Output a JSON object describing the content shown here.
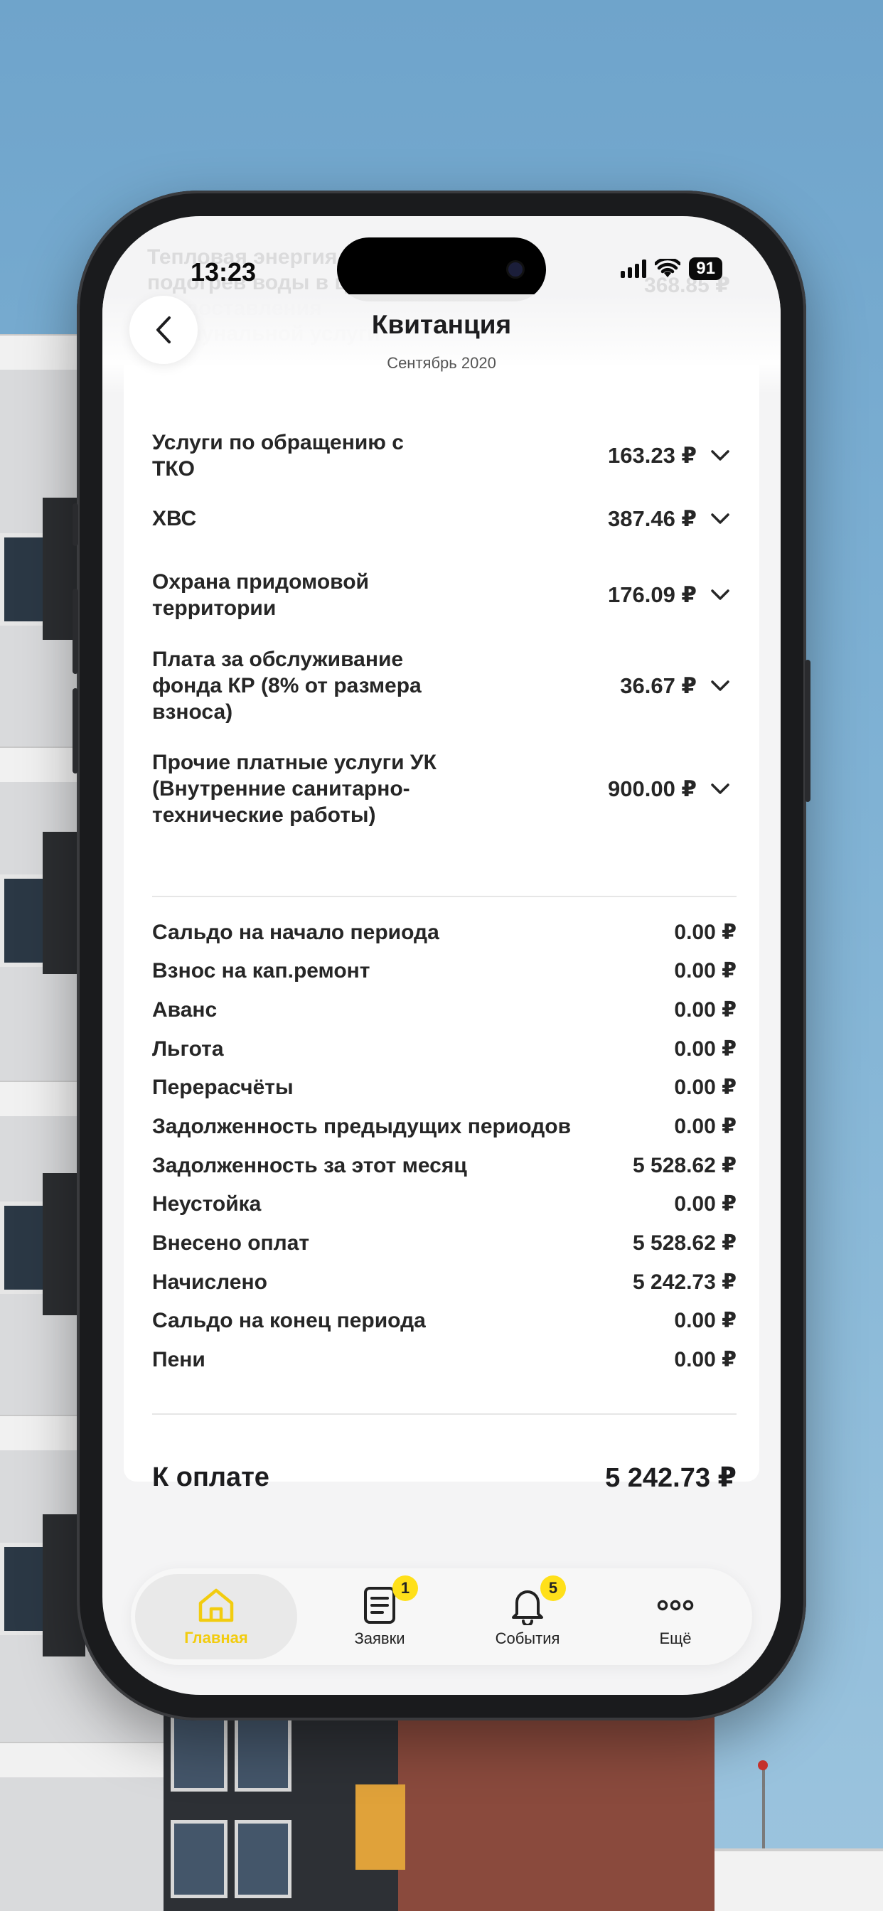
{
  "status_bar": {
    "time": "13:23",
    "battery": "91"
  },
  "header": {
    "title": "Квитанция",
    "subtitle": "Сентябрь 2020"
  },
  "ghost_row": {
    "name": "Тепловая энергия на подогрев воды в целях предоставления коммунальной услуги",
    "value": "368.85 ₽"
  },
  "services": [
    {
      "name": "Услуги по обращению с ТКО",
      "value": "163.23 ₽"
    },
    {
      "name": "ХВС",
      "value": "387.46 ₽"
    },
    {
      "name": "Охрана придомовой территории",
      "value": "176.09 ₽"
    },
    {
      "name": "Плата за обслуживание фонда КР (8% от размера взноса)",
      "value": "36.67 ₽"
    },
    {
      "name": "Прочие платные услуги УК (Внутренние санитарно-технические работы)",
      "value": "900.00 ₽"
    }
  ],
  "summary": [
    {
      "label": "Сальдо на начало периода",
      "value": "0.00 ₽"
    },
    {
      "label": "Взнос на кап.ремонт",
      "value": "0.00 ₽"
    },
    {
      "label": "Аванс",
      "value": "0.00 ₽"
    },
    {
      "label": "Льгота",
      "value": "0.00 ₽"
    },
    {
      "label": "Перерасчёты",
      "value": "0.00 ₽"
    },
    {
      "label": "Задолженность предыдущих периодов",
      "value": "0.00 ₽"
    },
    {
      "label": "Задолженность за этот месяц",
      "value": "5 528.62 ₽"
    },
    {
      "label": "Неустойка",
      "value": "0.00 ₽"
    },
    {
      "label": "Внесено оплат",
      "value": "5 528.62 ₽"
    },
    {
      "label": "Начислено",
      "value": "5 242.73 ₽"
    },
    {
      "label": "Сальдо на конец периода",
      "value": "0.00 ₽"
    },
    {
      "label": "Пени",
      "value": "0.00 ₽"
    }
  ],
  "total": {
    "label": "К оплате",
    "value": "5 242.73 ₽"
  },
  "tabbar": {
    "home": {
      "label": "Главная"
    },
    "requests": {
      "label": "Заявки",
      "badge": "1"
    },
    "events": {
      "label": "События",
      "badge": "5"
    },
    "more": {
      "label": "Ещё"
    }
  },
  "colors": {
    "accent": "#f2cc0f",
    "badge": "#ffe01a",
    "text": "#262626"
  }
}
